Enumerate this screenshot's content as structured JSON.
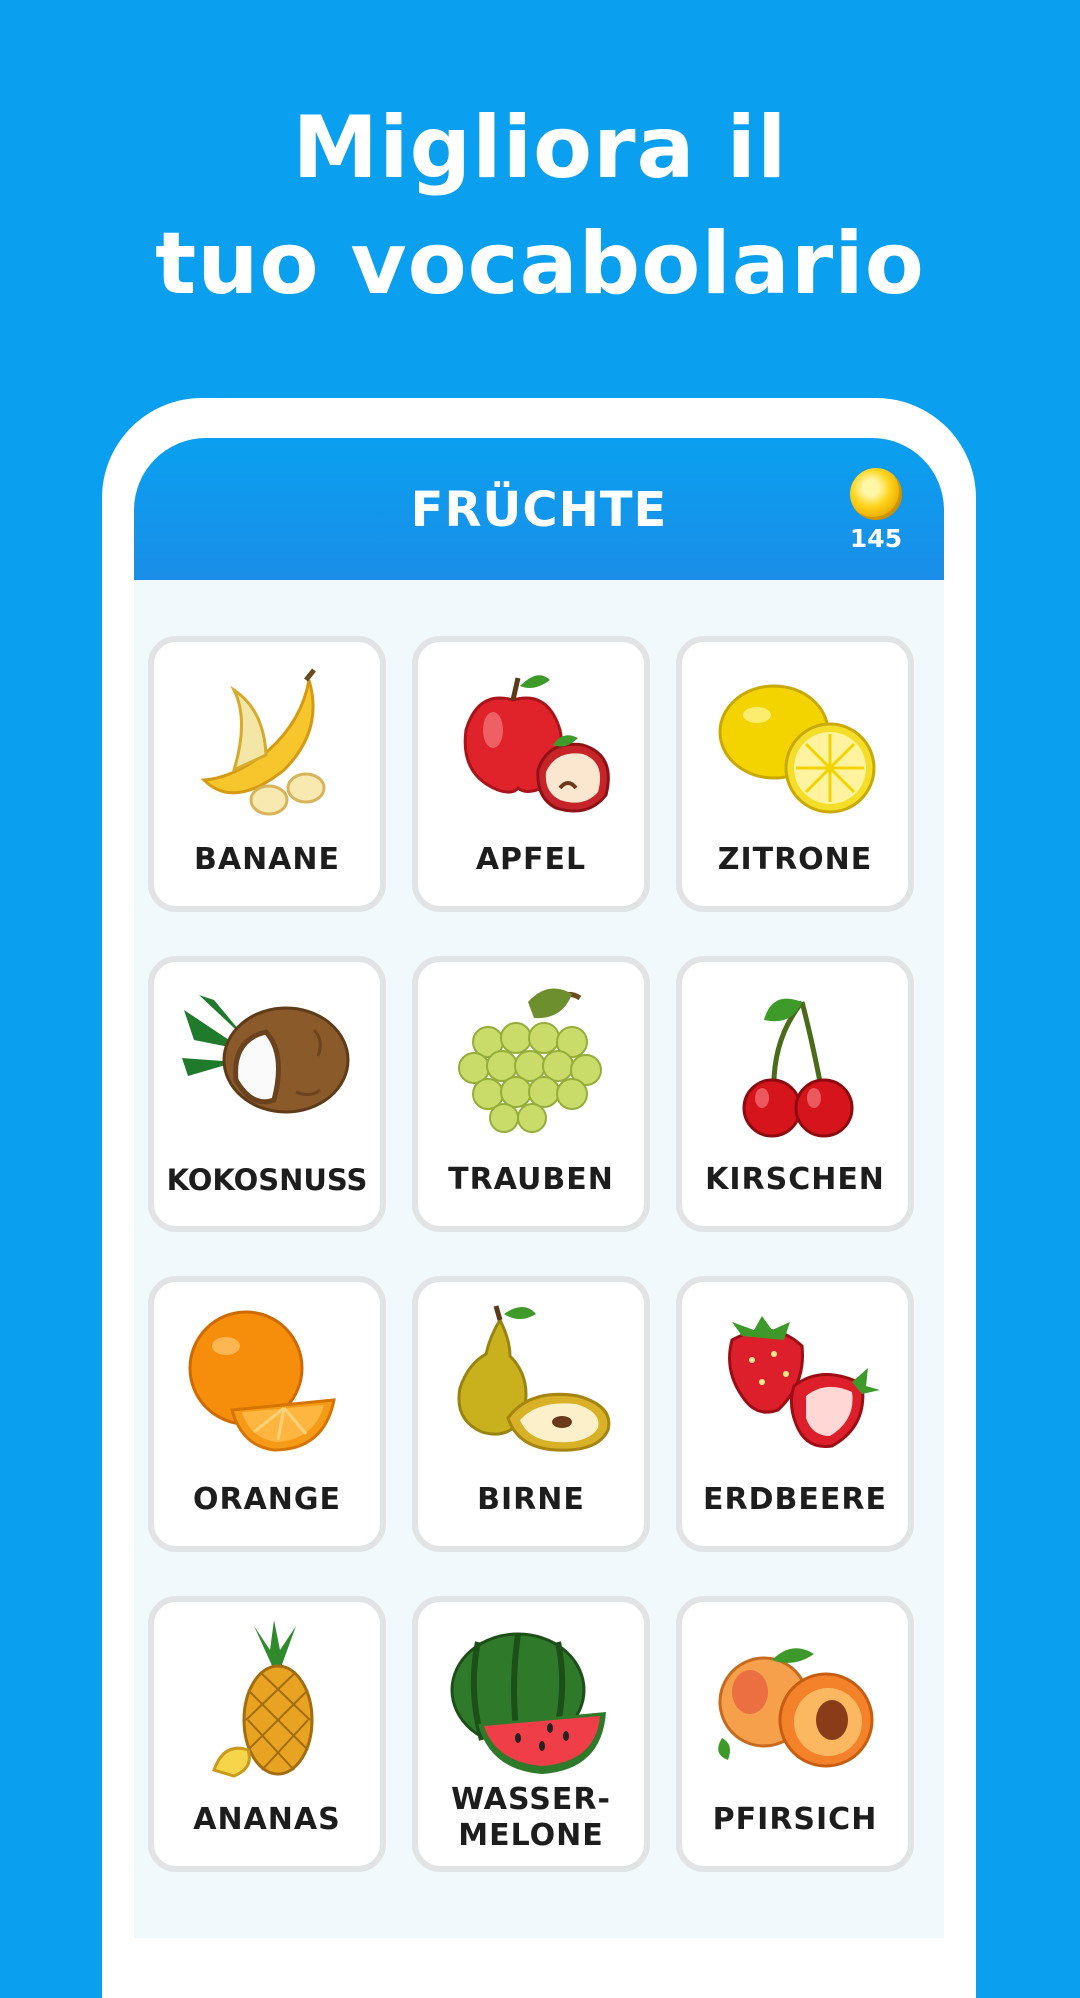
{
  "headline": {
    "line1": "Migliora il",
    "line2": "tuo vocabolario"
  },
  "app": {
    "title": "FRÜCHTE",
    "coins": "145"
  },
  "items": [
    {
      "label": "BANANE",
      "icon": "banana-icon"
    },
    {
      "label": "APFEL",
      "icon": "apple-icon"
    },
    {
      "label": "ZITRONE",
      "icon": "lemon-icon"
    },
    {
      "label": "KOKOSNUSS",
      "icon": "coconut-icon"
    },
    {
      "label": "TRAUBEN",
      "icon": "grapes-icon"
    },
    {
      "label": "KIRSCHEN",
      "icon": "cherries-icon"
    },
    {
      "label": "ORANGE",
      "icon": "orange-icon"
    },
    {
      "label": "BIRNE",
      "icon": "pear-icon"
    },
    {
      "label": "ERDBEERE",
      "icon": "strawberry-icon"
    },
    {
      "label": "ANANAS",
      "icon": "pineapple-icon"
    },
    {
      "label": "WASSER-",
      "label2": "MELONE",
      "icon": "watermelon-icon"
    },
    {
      "label": "PFIRSICH",
      "icon": "peach-icon"
    }
  ],
  "colors": {
    "background": "#0aa0ef",
    "appbar": "#1a8ee8",
    "card_border": "#e2e3e5"
  }
}
